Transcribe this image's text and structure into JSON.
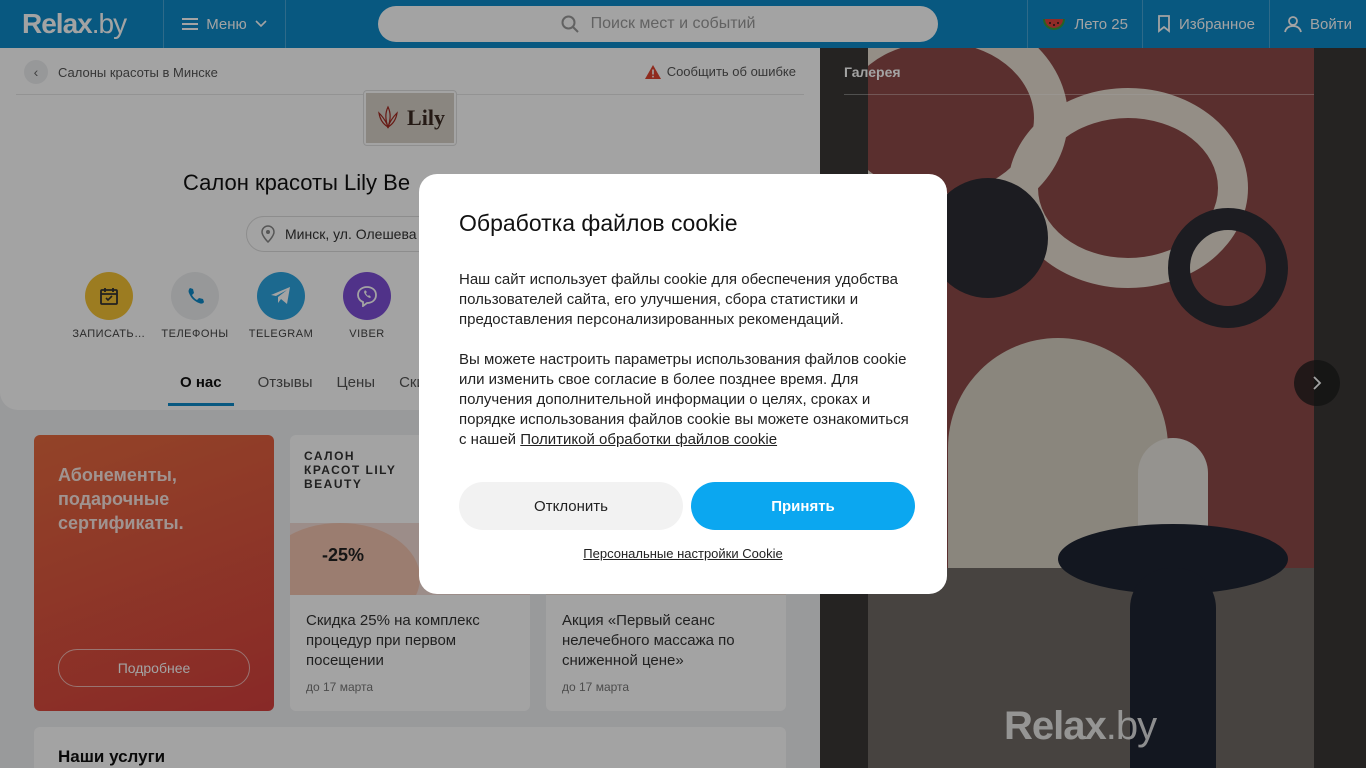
{
  "header": {
    "logo": "Relax",
    "logo_suffix": ".by",
    "menu_label": "Меню",
    "search_placeholder": "Поиск мест и событий",
    "summer_label": "Лето 25",
    "favorites_label": "Избранное",
    "login_label": "Войти"
  },
  "breadcrumb": {
    "label": "Салоны красоты в Минске"
  },
  "report_error": "Сообщить об ошибке",
  "salon": {
    "logo_text": "Lily",
    "name": "Салон красоты Lily Be",
    "address": "Минск, ул. Олешева"
  },
  "actions": [
    {
      "label": "ЗАПИСАТЬ…",
      "icon": "calendar-icon",
      "color": "#f5c335"
    },
    {
      "label": "ТЕЛЕФОНЫ",
      "icon": "phone-icon",
      "color": "#eceef0"
    },
    {
      "label": "TELEGRAM",
      "icon": "telegram-icon",
      "color": "#2ca5e0"
    },
    {
      "label": "VIBER",
      "icon": "viber-icon",
      "color": "#7d4fd6"
    }
  ],
  "tabs": [
    "О нас",
    "Отзывы",
    "Цены",
    "Скид"
  ],
  "promo": {
    "title": "Абонементы, подарочные сертификаты.",
    "button": "Подробнее"
  },
  "offers": [
    {
      "header": "САЛОН КРАСОТ LILY BEAUTY",
      "discount": "-25%",
      "text": "Скидка 25% на комплекс процедур при первом посещении",
      "date": "до 17 марта"
    },
    {
      "header": "",
      "discount": "",
      "text": "Акция «Первый сеанс нелечебного массажа по сниженной цене»",
      "date": "до 17 марта"
    }
  ],
  "services_title": "Наши услуги",
  "gallery": {
    "label": "Галерея",
    "watermark": "Relax",
    "watermark_suffix": ".by"
  },
  "cookie_modal": {
    "title": "Обработка файлов cookie",
    "paragraph1": "Наш сайт использует файлы cookie для обеспечения удобства пользователей сайта, его улучшения, сбора статистики и предоставления персонализированных рекомендаций.",
    "paragraph2": "Вы можете настроить параметры использования файлов cookie или изменить свое согласие в более позднее время. Для получения дополнительной информации о целях, сроках и порядке использования файлов cookie вы можете ознакомиться с нашей",
    "policy_link": "Политикой обработки файлов cookie",
    "decline": "Отклонить",
    "accept": "Принять",
    "personal_settings": "Персональные настройки Cookie"
  },
  "colors": {
    "brand": "#0d8ac9",
    "accept": "#0ba7f0"
  }
}
